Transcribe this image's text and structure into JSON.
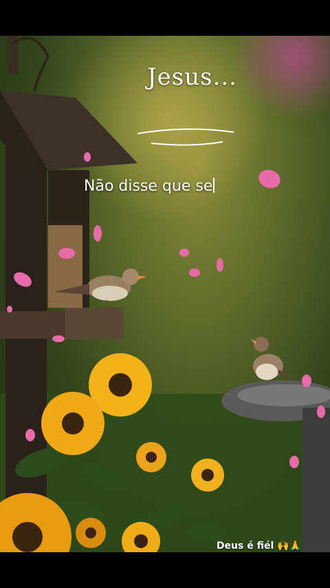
{
  "overlay": {
    "title": "Jesus...",
    "subtitle": "Não disse que se",
    "footer_text": "Deus é fiél",
    "footer_emoji": "🙌🙏"
  },
  "colors": {
    "petal": "#e86aa8",
    "sunflower": "#f3b21a",
    "background_green": "#3d5420"
  }
}
